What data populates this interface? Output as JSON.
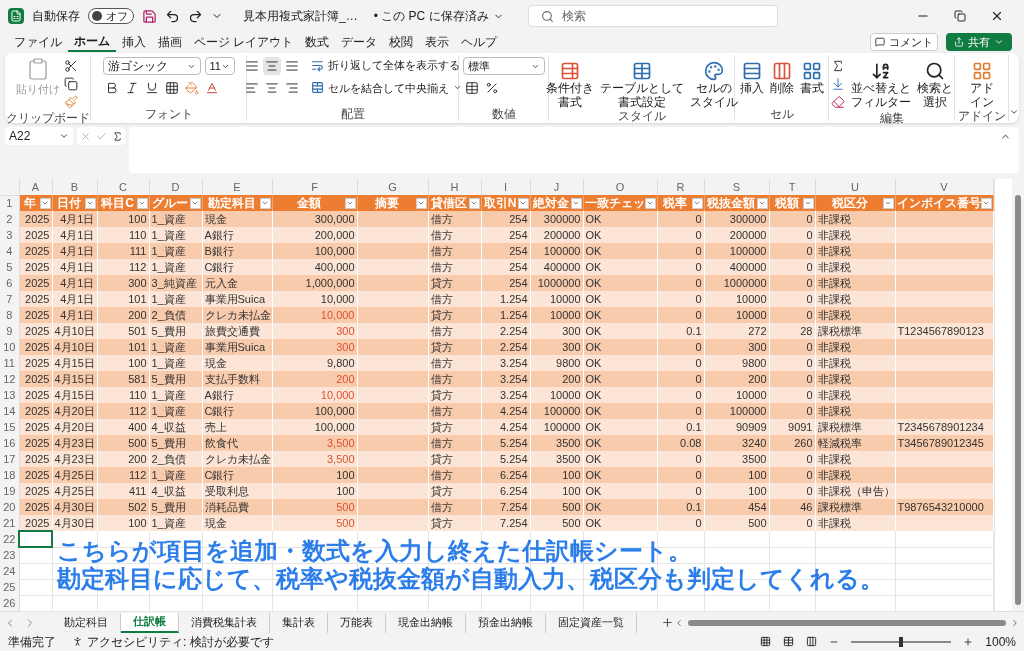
{
  "titlebar": {
    "autosave_label": "自動保存",
    "autosave": {
      "on": false,
      "label": "オフ"
    },
    "filename": "見本用複式家計簿_…",
    "save_status": "• この PC に保存済み",
    "search_placeholder": "検索"
  },
  "menu_tabs": [
    {
      "label": "ファイル",
      "selected": false
    },
    {
      "label": "ホーム",
      "selected": true
    },
    {
      "label": "挿入",
      "selected": false
    },
    {
      "label": "描画",
      "selected": false
    },
    {
      "label": "ページ レイアウト",
      "selected": false
    },
    {
      "label": "数式",
      "selected": false
    },
    {
      "label": "データ",
      "selected": false
    },
    {
      "label": "校閲",
      "selected": false
    },
    {
      "label": "表示",
      "selected": false
    },
    {
      "label": "ヘルプ",
      "selected": false
    }
  ],
  "comment_button": "コメント",
  "share_button": "共有",
  "ribbon": {
    "clipboard": {
      "label": "クリップボード",
      "paste": "貼り付け"
    },
    "font": {
      "label": "フォント",
      "font_name": "游ゴシック",
      "font_size": "11"
    },
    "alignment": {
      "label": "配置",
      "wrap": "折り返して全体を表示する",
      "merge": "セルを結合して中央揃え"
    },
    "number": {
      "label": "数値",
      "format": "標準"
    },
    "styles": {
      "label": "スタイル",
      "buttons": [
        [
          "条件付き",
          "書式"
        ],
        [
          "テーブルとして",
          "書式設定"
        ],
        [
          "セルの",
          "スタイル"
        ]
      ]
    },
    "cells": {
      "label": "セル",
      "buttons": [
        "挿入",
        "削除",
        "書式"
      ]
    },
    "editing": {
      "label": "編集",
      "buttons": [
        [
          "並べ替えと",
          "フィルター"
        ],
        [
          "検索と",
          "選択"
        ]
      ]
    },
    "addins": {
      "label": "アドイン",
      "button": [
        "アド",
        "イン"
      ]
    }
  },
  "name_box": "A22",
  "columns": [
    {
      "letter": "A",
      "header": "年"
    },
    {
      "letter": "B",
      "header": "日付"
    },
    {
      "letter": "C",
      "header": "科目C"
    },
    {
      "letter": "D",
      "header": "グルー"
    },
    {
      "letter": "E",
      "header": "勘定科目"
    },
    {
      "letter": "F",
      "header": "金額"
    },
    {
      "letter": "G",
      "header": "摘要"
    },
    {
      "letter": "H",
      "header": "貸借区"
    },
    {
      "letter": "I",
      "header": "取引N"
    },
    {
      "letter": "J",
      "header": "絶対金"
    },
    {
      "letter": "O",
      "header": "一致チェッ"
    },
    {
      "letter": "R",
      "header": "税率"
    },
    {
      "letter": "S",
      "header": "税抜金額"
    },
    {
      "letter": "T",
      "header": "税額"
    },
    {
      "letter": "U",
      "header": "税区分"
    },
    {
      "letter": "V",
      "header": "インボイス番号"
    }
  ],
  "header_row_no": "1",
  "rows": [
    {
      "row_no": "2",
      "year": "2025",
      "date": "4月1日",
      "code": "100",
      "group": "1_資産",
      "account": "現金",
      "amount": "300,000",
      "amount_red": false,
      "side": "借方",
      "txn_no": "254",
      "abs_amount": "300000",
      "check": "OK",
      "tax_rate": "0",
      "net_amount": "300000",
      "tax": "0",
      "tax_class": "非課税"
    },
    {
      "row_no": "3",
      "year": "2025",
      "date": "4月1日",
      "code": "110",
      "group": "1_資産",
      "account": "A銀行",
      "amount": "200,000",
      "amount_red": false,
      "side": "借方",
      "txn_no": "254",
      "abs_amount": "200000",
      "check": "OK",
      "tax_rate": "0",
      "net_amount": "200000",
      "tax": "0",
      "tax_class": "非課税"
    },
    {
      "row_no": "4",
      "year": "2025",
      "date": "4月1日",
      "code": "111",
      "group": "1_資産",
      "account": "B銀行",
      "amount": "100,000",
      "amount_red": false,
      "side": "借方",
      "txn_no": "254",
      "abs_amount": "100000",
      "check": "OK",
      "tax_rate": "0",
      "net_amount": "100000",
      "tax": "0",
      "tax_class": "非課税"
    },
    {
      "row_no": "5",
      "year": "2025",
      "date": "4月1日",
      "code": "112",
      "group": "1_資産",
      "account": "C銀行",
      "amount": "400,000",
      "amount_red": false,
      "side": "借方",
      "txn_no": "254",
      "abs_amount": "400000",
      "check": "OK",
      "tax_rate": "0",
      "net_amount": "400000",
      "tax": "0",
      "tax_class": "非課税"
    },
    {
      "row_no": "6",
      "year": "2025",
      "date": "4月1日",
      "code": "300",
      "group": "3_純資産",
      "account": "元入金",
      "amount": "1,000,000",
      "amount_red": false,
      "side": "貸方",
      "txn_no": "254",
      "abs_amount": "1000000",
      "check": "OK",
      "tax_rate": "0",
      "net_amount": "1000000",
      "tax": "0",
      "tax_class": "非課税"
    },
    {
      "row_no": "7",
      "year": "2025",
      "date": "4月1日",
      "code": "101",
      "group": "1_資産",
      "account": "事業用Suica",
      "amount": "10,000",
      "amount_red": false,
      "side": "借方",
      "txn_no": "1.254",
      "abs_amount": "10000",
      "check": "OK",
      "tax_rate": "0",
      "net_amount": "10000",
      "tax": "0",
      "tax_class": "非課税"
    },
    {
      "row_no": "8",
      "year": "2025",
      "date": "4月1日",
      "code": "200",
      "group": "2_負債",
      "account": "クレカ未払金",
      "amount": "10,000",
      "amount_red": true,
      "side": "貸方",
      "txn_no": "1.254",
      "abs_amount": "10000",
      "check": "OK",
      "tax_rate": "0",
      "net_amount": "10000",
      "tax": "0",
      "tax_class": "非課税"
    },
    {
      "row_no": "9",
      "year": "2025",
      "date": "4月10日",
      "code": "501",
      "group": "5_費用",
      "account": "旅費交通費",
      "amount": "300",
      "amount_red": true,
      "side": "借方",
      "txn_no": "2.254",
      "abs_amount": "300",
      "check": "OK",
      "tax_rate": "0.1",
      "net_amount": "272",
      "tax": "28",
      "tax_class": "課税標準",
      "invoice": "T1234567890123"
    },
    {
      "row_no": "10",
      "year": "2025",
      "date": "4月10日",
      "code": "101",
      "group": "1_資産",
      "account": "事業用Suica",
      "amount": "300",
      "amount_red": true,
      "side": "貸方",
      "txn_no": "2.254",
      "abs_amount": "300",
      "check": "OK",
      "tax_rate": "0",
      "net_amount": "300",
      "tax": "0",
      "tax_class": "非課税"
    },
    {
      "row_no": "11",
      "year": "2025",
      "date": "4月15日",
      "code": "100",
      "group": "1_資産",
      "account": "現金",
      "amount": "9,800",
      "amount_red": false,
      "side": "借方",
      "txn_no": "3.254",
      "abs_amount": "9800",
      "check": "OK",
      "tax_rate": "0",
      "net_amount": "9800",
      "tax": "0",
      "tax_class": "非課税"
    },
    {
      "row_no": "12",
      "year": "2025",
      "date": "4月15日",
      "code": "581",
      "group": "5_費用",
      "account": "支払手数料",
      "amount": "200",
      "amount_red": true,
      "side": "借方",
      "txn_no": "3.254",
      "abs_amount": "200",
      "check": "OK",
      "tax_rate": "0",
      "net_amount": "200",
      "tax": "0",
      "tax_class": "非課税"
    },
    {
      "row_no": "13",
      "year": "2025",
      "date": "4月15日",
      "code": "110",
      "group": "1_資産",
      "account": "A銀行",
      "amount": "10,000",
      "amount_red": true,
      "side": "貸方",
      "txn_no": "3.254",
      "abs_amount": "10000",
      "check": "OK",
      "tax_rate": "0",
      "net_amount": "10000",
      "tax": "0",
      "tax_class": "非課税"
    },
    {
      "row_no": "14",
      "year": "2025",
      "date": "4月20日",
      "code": "112",
      "group": "1_資産",
      "account": "C銀行",
      "amount": "100,000",
      "amount_red": false,
      "side": "借方",
      "txn_no": "4.254",
      "abs_amount": "100000",
      "check": "OK",
      "tax_rate": "0",
      "net_amount": "100000",
      "tax": "0",
      "tax_class": "非課税"
    },
    {
      "row_no": "15",
      "year": "2025",
      "date": "4月20日",
      "code": "400",
      "group": "4_収益",
      "account": "売上",
      "amount": "100,000",
      "amount_red": false,
      "side": "貸方",
      "txn_no": "4.254",
      "abs_amount": "100000",
      "check": "OK",
      "tax_rate": "0.1",
      "net_amount": "90909",
      "tax": "9091",
      "tax_class": "課税標準",
      "invoice": "T2345678901234"
    },
    {
      "row_no": "16",
      "year": "2025",
      "date": "4月23日",
      "code": "500",
      "group": "5_費用",
      "account": "飲食代",
      "amount": "3,500",
      "amount_red": true,
      "side": "借方",
      "txn_no": "5.254",
      "abs_amount": "3500",
      "check": "OK",
      "tax_rate": "0.08",
      "net_amount": "3240",
      "tax": "260",
      "tax_class": "軽減税率",
      "invoice": "T3456789012345"
    },
    {
      "row_no": "17",
      "year": "2025",
      "date": "4月23日",
      "code": "200",
      "group": "2_負債",
      "account": "クレカ未払金",
      "amount": "3,500",
      "amount_red": true,
      "side": "貸方",
      "txn_no": "5.254",
      "abs_amount": "3500",
      "check": "OK",
      "tax_rate": "0",
      "net_amount": "3500",
      "tax": "0",
      "tax_class": "非課税"
    },
    {
      "row_no": "18",
      "year": "2025",
      "date": "4月25日",
      "code": "112",
      "group": "1_資産",
      "account": "C銀行",
      "amount": "100",
      "amount_red": false,
      "side": "借方",
      "txn_no": "6.254",
      "abs_amount": "100",
      "check": "OK",
      "tax_rate": "0",
      "net_amount": "100",
      "tax": "0",
      "tax_class": "非課税"
    },
    {
      "row_no": "19",
      "year": "2025",
      "date": "4月25日",
      "code": "411",
      "group": "4_収益",
      "account": "受取利息",
      "amount": "100",
      "amount_red": false,
      "side": "貸方",
      "txn_no": "6.254",
      "abs_amount": "100",
      "check": "OK",
      "tax_rate": "0",
      "net_amount": "100",
      "tax": "0",
      "tax_class": "非課税（申告）"
    },
    {
      "row_no": "20",
      "year": "2025",
      "date": "4月30日",
      "code": "502",
      "group": "5_費用",
      "account": "消耗品費",
      "amount": "500",
      "amount_red": true,
      "side": "借方",
      "txn_no": "7.254",
      "abs_amount": "500",
      "check": "OK",
      "tax_rate": "0.1",
      "net_amount": "454",
      "tax": "46",
      "tax_class": "課税標準",
      "invoice": "T9876543210000"
    },
    {
      "row_no": "21",
      "year": "2025",
      "date": "4月30日",
      "code": "100",
      "group": "1_資産",
      "account": "現金",
      "amount": "500",
      "amount_red": true,
      "side": "貸方",
      "txn_no": "7.254",
      "abs_amount": "500",
      "check": "OK",
      "tax_rate": "0",
      "net_amount": "500",
      "tax": "0",
      "tax_class": "非課税"
    }
  ],
  "empty_rows": [
    {
      "row_no": "22",
      "selected": true
    },
    {
      "row_no": "23",
      "selected": false
    },
    {
      "row_no": "24",
      "selected": false
    },
    {
      "row_no": "25",
      "selected": false
    },
    {
      "row_no": "26",
      "selected": false
    }
  ],
  "overlay_caption": [
    "こちらが項目を追加・数式を入力し終えた仕訳帳シート。",
    "勘定科目に応じて、税率や税抜金額が自動入力、税区分も判定してくれる。"
  ],
  "sheet_tabs": [
    {
      "label": "勘定科目",
      "selected": false
    },
    {
      "label": "仕訳帳",
      "selected": true
    },
    {
      "label": "消費税集計表",
      "selected": false
    },
    {
      "label": "集計表",
      "selected": false
    },
    {
      "label": "万能表",
      "selected": false
    },
    {
      "label": "現金出納帳",
      "selected": false
    },
    {
      "label": "預金出納帳",
      "selected": false
    },
    {
      "label": "固定資産一覧",
      "selected": false
    }
  ],
  "status_bar": {
    "ready": "準備完了",
    "accessibility": "アクセシビリティ: 検討が必要です",
    "zoom": {
      "label": "100%",
      "level": 0.5
    }
  }
}
